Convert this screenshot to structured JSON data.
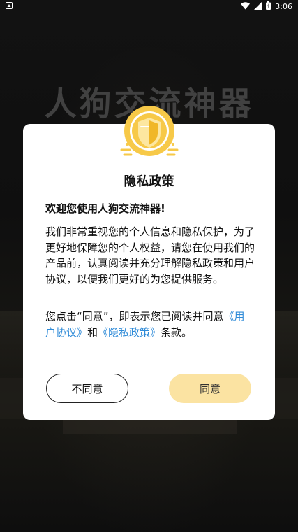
{
  "status_bar": {
    "time": "3:06",
    "left_icon": "android-notification-icon",
    "wifi_icon": "wifi-icon",
    "signal_icon": "signal-icon",
    "battery_icon": "battery-charging-icon"
  },
  "background": {
    "app_title": "人狗交流神器"
  },
  "dialog": {
    "title": "隐私政策",
    "welcome": "欢迎您使用人狗交流神器!",
    "body": "我们非常重视您的个人信息和隐私保护，为了更好地保障您的个人权益，请您在使用我们的产品前，认真阅读并充分理解隐私政策和用户协议，以便我们更好的为您提供服务。",
    "consent": {
      "prefix": "您点击“同意”，即表示您已阅读并同意",
      "user_agreement_link": "《用户协议》",
      "and": "和",
      "privacy_policy_link": "《隐私政策》",
      "suffix": "条款。"
    },
    "decline_button": "不同意",
    "agree_button": "同意",
    "accent_color": "#fbe3a2",
    "link_color": "#2f8bd8",
    "shield_color": "#f7c948"
  }
}
